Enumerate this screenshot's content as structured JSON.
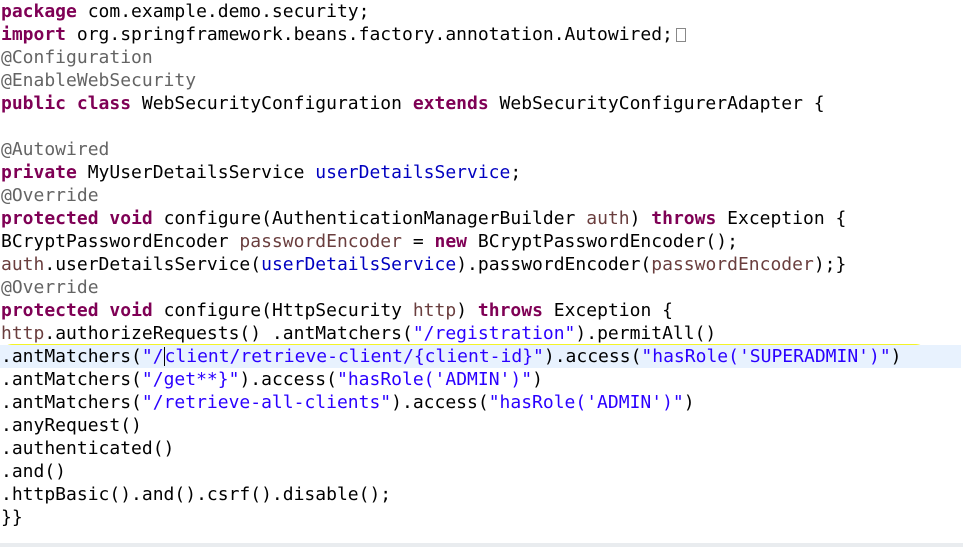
{
  "editor": {
    "current_line": 15,
    "caret": {
      "line": 15,
      "after_token": 1
    },
    "highlight_line": 15,
    "colors": {
      "keyword": "#7f0055",
      "annotation": "#646464",
      "string": "#2a00ff",
      "field": "#0000c0",
      "parameter": "#6a3e3e",
      "plain": "#000000",
      "marker": "#f2f200",
      "current_line_bg": "#e8f2fe"
    },
    "lines": [
      [
        {
          "t": "kw",
          "v": "package"
        },
        {
          "t": "plain",
          "v": " com.example.demo.security;"
        }
      ],
      [
        {
          "t": "kw",
          "v": "import"
        },
        {
          "t": "plain",
          "v": " org.springframework.beans.factory.annotation.Autowired;"
        },
        {
          "t": "fold",
          "v": ""
        }
      ],
      [
        {
          "t": "ann",
          "v": "@Configuration"
        }
      ],
      [
        {
          "t": "ann",
          "v": "@EnableWebSecurity"
        }
      ],
      [
        {
          "t": "kw",
          "v": "public"
        },
        {
          "t": "plain",
          "v": " "
        },
        {
          "t": "kw",
          "v": "class"
        },
        {
          "t": "plain",
          "v": " WebSecurityConfiguration "
        },
        {
          "t": "kw",
          "v": "extends"
        },
        {
          "t": "plain",
          "v": " WebSecurityConfigurerAdapter {"
        }
      ],
      [],
      [
        {
          "t": "ann",
          "v": "@Autowired"
        }
      ],
      [
        {
          "t": "kw",
          "v": "private"
        },
        {
          "t": "plain",
          "v": " MyUserDetailsService "
        },
        {
          "t": "fld",
          "v": "userDetailsService"
        },
        {
          "t": "plain",
          "v": ";"
        }
      ],
      [
        {
          "t": "ann",
          "v": "@Override"
        }
      ],
      [
        {
          "t": "kw",
          "v": "protected"
        },
        {
          "t": "plain",
          "v": " "
        },
        {
          "t": "kw",
          "v": "void"
        },
        {
          "t": "plain",
          "v": " configure(AuthenticationManagerBuilder "
        },
        {
          "t": "prm",
          "v": "auth"
        },
        {
          "t": "plain",
          "v": ") "
        },
        {
          "t": "kw",
          "v": "throws"
        },
        {
          "t": "plain",
          "v": " Exception {"
        }
      ],
      [
        {
          "t": "plain",
          "v": "BCryptPasswordEncoder "
        },
        {
          "t": "prm",
          "v": "passwordEncoder"
        },
        {
          "t": "plain",
          "v": " = "
        },
        {
          "t": "kw",
          "v": "new"
        },
        {
          "t": "plain",
          "v": " BCryptPasswordEncoder();"
        }
      ],
      [
        {
          "t": "prm",
          "v": "auth"
        },
        {
          "t": "plain",
          "v": ".userDetailsService("
        },
        {
          "t": "fld",
          "v": "userDetailsService"
        },
        {
          "t": "plain",
          "v": ").passwordEncoder("
        },
        {
          "t": "prm",
          "v": "passwordEncoder"
        },
        {
          "t": "plain",
          "v": ");}"
        }
      ],
      [
        {
          "t": "ann",
          "v": "@Override"
        }
      ],
      [
        {
          "t": "kw",
          "v": "protected"
        },
        {
          "t": "plain",
          "v": " "
        },
        {
          "t": "kw",
          "v": "void"
        },
        {
          "t": "plain",
          "v": " configure(HttpSecurity "
        },
        {
          "t": "prm",
          "v": "http"
        },
        {
          "t": "plain",
          "v": ") "
        },
        {
          "t": "kw",
          "v": "throws"
        },
        {
          "t": "plain",
          "v": " Exception {"
        }
      ],
      [
        {
          "t": "prm",
          "v": "http"
        },
        {
          "t": "plain",
          "v": ".authorizeRequests() .antMatchers("
        },
        {
          "t": "str",
          "v": "\"/registration\""
        },
        {
          "t": "plain",
          "v": ").permitAll()"
        }
      ],
      [
        {
          "t": "plain",
          "v": ".antMatchers("
        },
        {
          "t": "str",
          "v": "\"/"
        },
        {
          "t": "caret",
          "v": ""
        },
        {
          "t": "str",
          "v": "client/retrieve-client/{client-id}\""
        },
        {
          "t": "plain",
          "v": ").access("
        },
        {
          "t": "str",
          "v": "\"hasRole('SUPERADMIN')\""
        },
        {
          "t": "plain",
          "v": ")"
        }
      ],
      [
        {
          "t": "plain",
          "v": ".antMatchers("
        },
        {
          "t": "str",
          "v": "\"/get**}\""
        },
        {
          "t": "plain",
          "v": ").access("
        },
        {
          "t": "str",
          "v": "\"hasRole('ADMIN')\""
        },
        {
          "t": "plain",
          "v": ")"
        }
      ],
      [
        {
          "t": "plain",
          "v": ".antMatchers("
        },
        {
          "t": "str",
          "v": "\"/retrieve-all-clients\""
        },
        {
          "t": "plain",
          "v": ").access("
        },
        {
          "t": "str",
          "v": "\"hasRole('ADMIN')\""
        },
        {
          "t": "plain",
          "v": ")"
        }
      ],
      [
        {
          "t": "plain",
          "v": ".anyRequest()"
        }
      ],
      [
        {
          "t": "plain",
          "v": ".authenticated()"
        }
      ],
      [
        {
          "t": "plain",
          "v": ".and()"
        }
      ],
      [
        {
          "t": "plain",
          "v": ".httpBasic().and().csrf().disable();"
        }
      ],
      [
        {
          "t": "plain",
          "v": "}}"
        }
      ]
    ]
  }
}
